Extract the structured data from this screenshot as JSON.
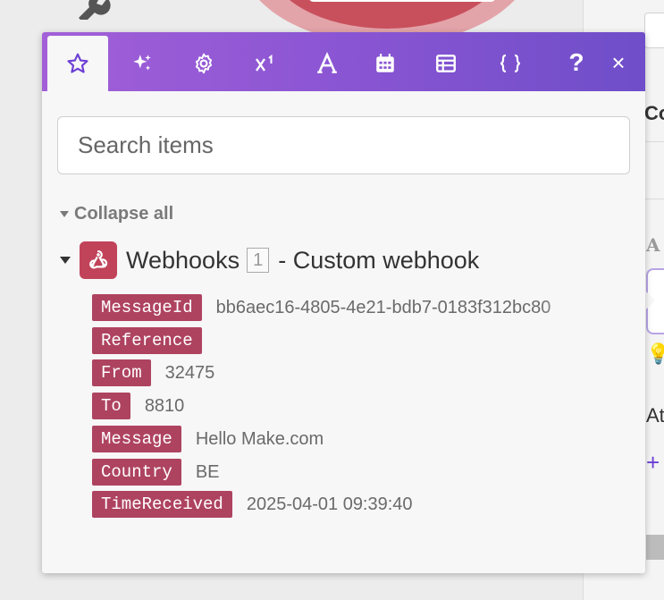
{
  "toolbar": {
    "tabs": [
      {
        "name": "star-icon",
        "label": "Favorites"
      },
      {
        "name": "sparkles-icon",
        "label": "AI"
      },
      {
        "name": "gear-icon",
        "label": "General functions"
      },
      {
        "name": "superscript-icon",
        "label": "Math functions"
      },
      {
        "name": "text-icon",
        "label": "Text functions"
      },
      {
        "name": "calendar-icon",
        "label": "Date functions"
      },
      {
        "name": "table-icon",
        "label": "Array functions"
      },
      {
        "name": "braces-icon",
        "label": "Custom functions"
      }
    ],
    "help_label": "?",
    "close_label": "×"
  },
  "search": {
    "placeholder": "Search items",
    "value": ""
  },
  "collapse_all_label": "Collapse all",
  "module": {
    "name": "Webhooks",
    "number": "1",
    "subtitle": "- Custom webhook",
    "icon": "webhook-icon",
    "color": "#c1435a"
  },
  "items": [
    {
      "key": "MessageId",
      "value": "bb6aec16-4805-4e21-bdb7-0183f312bc80"
    },
    {
      "key": "Reference",
      "value": ""
    },
    {
      "key": "From",
      "value": "32475"
    },
    {
      "key": "To",
      "value": "8810"
    },
    {
      "key": "Message",
      "value": "Hello Make.com"
    },
    {
      "key": "Country",
      "value": "BE"
    },
    {
      "key": "TimeReceived",
      "value": "2025-04-01 09:39:40"
    }
  ],
  "right_panel": {
    "heading_partial": "Co",
    "a_glyph": "A",
    "at_partial": "At",
    "plus_glyph": "+",
    "bulb_glyph": "💡"
  },
  "colors": {
    "accent": "#6d3fd6",
    "pill": "#ae4360",
    "toolbar_start": "#a25fd8",
    "toolbar_end": "#6f4ec9"
  }
}
